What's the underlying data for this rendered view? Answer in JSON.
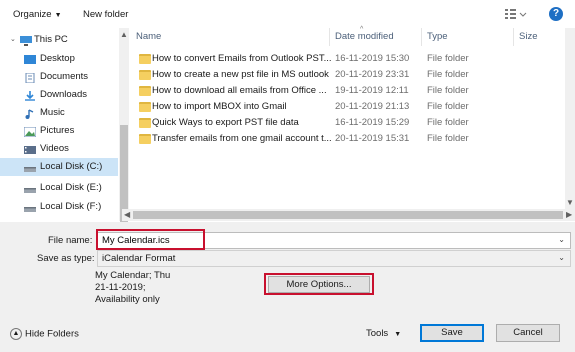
{
  "toolbar": {
    "organize_label": "Organize",
    "new_folder_label": "New folder",
    "help_label": "?"
  },
  "nav": {
    "items": [
      {
        "label": "This PC",
        "icon": "pc-icon"
      },
      {
        "label": "Desktop",
        "icon": "desktop-icon"
      },
      {
        "label": "Documents",
        "icon": "documents-icon"
      },
      {
        "label": "Downloads",
        "icon": "downloads-icon"
      },
      {
        "label": "Music",
        "icon": "music-icon"
      },
      {
        "label": "Pictures",
        "icon": "pictures-icon"
      },
      {
        "label": "Videos",
        "icon": "videos-icon"
      },
      {
        "label": "Local Disk (C:)",
        "icon": "drive-icon",
        "selected": true
      },
      {
        "label": "Local Disk (E:)",
        "icon": "drive-icon"
      },
      {
        "label": "Local Disk (F:)",
        "icon": "drive-icon"
      }
    ]
  },
  "columns": {
    "name": "Name",
    "date": "Date modified",
    "type": "Type",
    "size": "Size"
  },
  "files": [
    {
      "name": "How to convert Emails from Outlook PST...",
      "date": "16-11-2019 15:30",
      "type": "File folder"
    },
    {
      "name": "How to create a new pst file in MS outlook",
      "date": "20-11-2019 23:31",
      "type": "File folder"
    },
    {
      "name": "How to download all emails from Office ...",
      "date": "19-11-2019 12:11",
      "type": "File folder"
    },
    {
      "name": "How to import MBOX into Gmail",
      "date": "20-11-2019 21:13",
      "type": "File folder"
    },
    {
      "name": "Quick Ways to export PST file data",
      "date": "16-11-2019 15:29",
      "type": "File folder"
    },
    {
      "name": "Transfer emails from one gmail account t...",
      "date": "20-11-2019 15:31",
      "type": "File folder"
    }
  ],
  "form": {
    "file_name_label": "File name:",
    "file_name_value": "My Calendar.ics",
    "save_as_type_label": "Save as type:",
    "save_as_type_value": "iCalendar Format",
    "description": "My Calendar; Thu 21-11-2019; Availability only",
    "more_options_label": "More Options..."
  },
  "footer": {
    "hide_folders_label": "Hide Folders",
    "tools_label": "Tools",
    "save_label": "Save",
    "cancel_label": "Cancel"
  },
  "colors": {
    "accent": "#0078d7",
    "highlight_box": "#c8102e",
    "selection": "#cce4f7",
    "folder": "#f5cf60"
  }
}
